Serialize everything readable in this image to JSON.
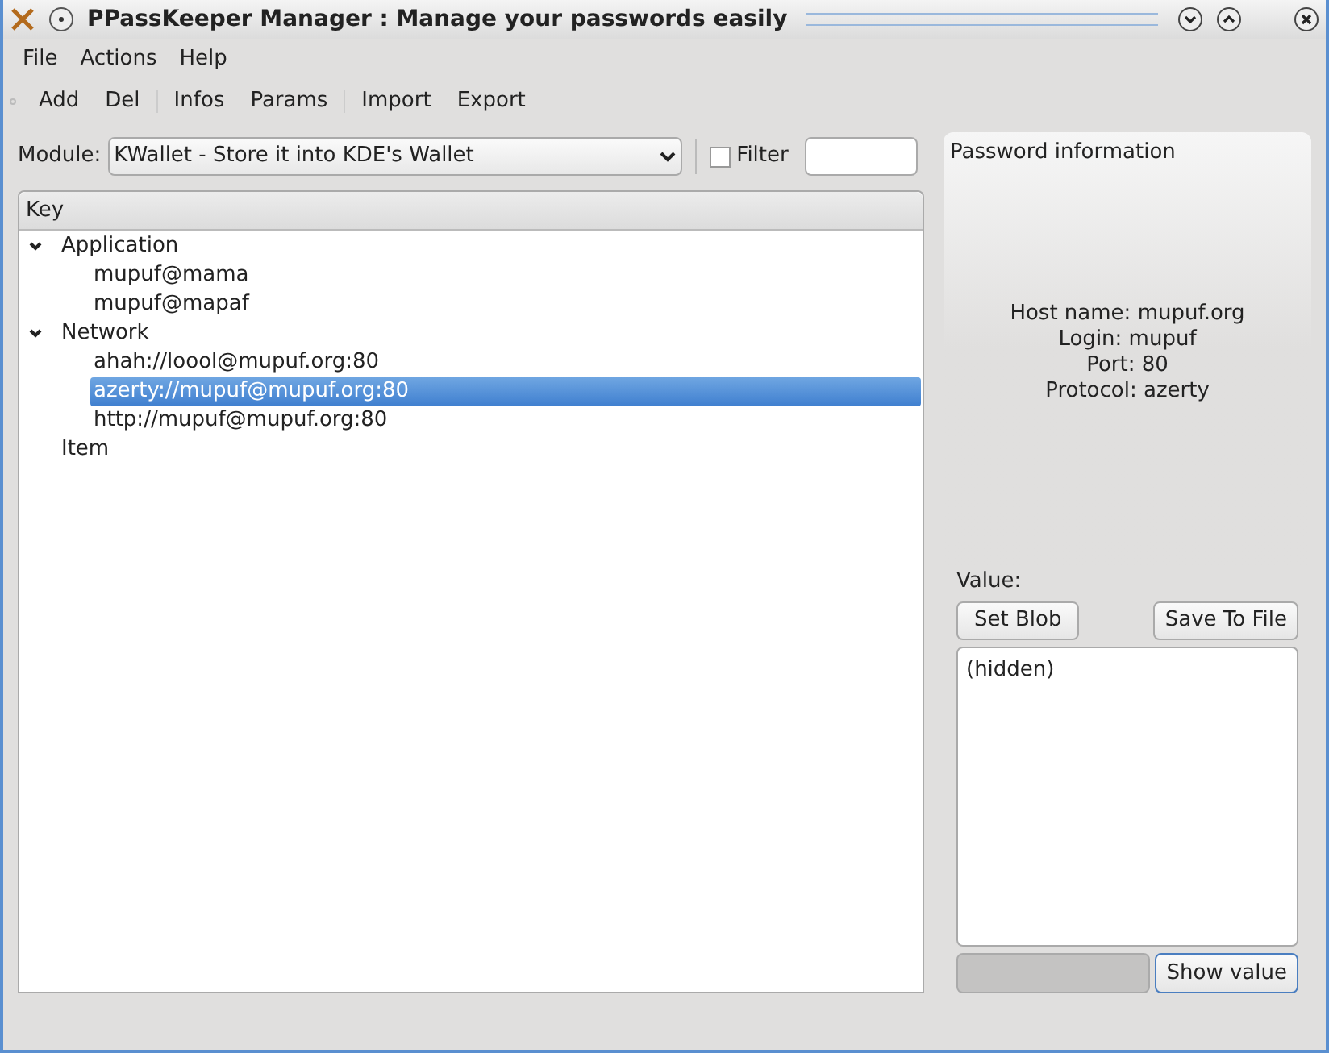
{
  "window": {
    "title": "PPassKeeper Manager : Manage your passwords easily"
  },
  "menu": [
    "File",
    "Actions",
    "Help"
  ],
  "toolbar": [
    [
      "Add",
      "Del"
    ],
    [
      "Infos",
      "Params"
    ],
    [
      "Import",
      "Export"
    ]
  ],
  "module": {
    "label": "Module:",
    "value": "KWallet - Store it into KDE's Wallet"
  },
  "filter": {
    "label": "Filter",
    "checked": false
  },
  "tree": {
    "column": "Key",
    "items": [
      {
        "label": "Application",
        "expanded": true,
        "selected": false,
        "children": [
          {
            "label": "mupuf@mama",
            "selected": false
          },
          {
            "label": "mupuf@mapaf",
            "selected": false
          }
        ]
      },
      {
        "label": "Network",
        "expanded": true,
        "selected": false,
        "children": [
          {
            "label": "ahah://loool@mupuf.org:80",
            "selected": false
          },
          {
            "label": "azerty://mupuf@mupuf.org:80",
            "selected": true
          },
          {
            "label": "http://mupuf@mupuf.org:80",
            "selected": false
          }
        ]
      },
      {
        "label": "Item",
        "selected": false
      }
    ]
  },
  "info": {
    "title": "Password information",
    "lines": [
      "Host name: mupuf.org",
      "Login: mupuf",
      "Port: 80",
      "Protocol: azerty"
    ]
  },
  "value": {
    "label": "Value:",
    "buttons": [
      "Set Blob",
      "Save To File"
    ],
    "text": "(hidden)",
    "show_button": "Show value"
  }
}
